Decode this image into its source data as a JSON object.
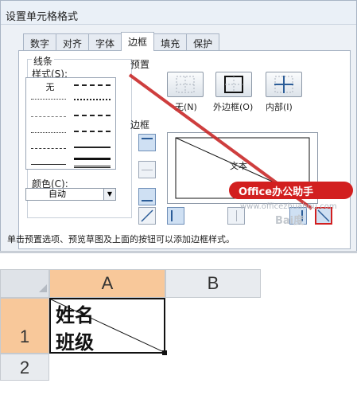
{
  "dialog": {
    "title": "设置单元格格式",
    "tabs": [
      "数字",
      "对齐",
      "字体",
      "边框",
      "填充",
      "保护"
    ],
    "active_tab": "边框",
    "line_section": "线条",
    "style_label": "样式(S):",
    "style_none": "无",
    "color_label": "颜色(C):",
    "color_value": "自动",
    "presets_label": "预置",
    "preset_none": "无(N)",
    "preset_outline": "外边框(O)",
    "preset_inside": "内部(I)",
    "border_label": "边框",
    "preview_text": "文本",
    "hint": "单击预置选项、预览草图及上面的按钮可以添加边框样式。"
  },
  "overlay": {
    "badge": "Office办公助手",
    "watermark": "www.officezhuahou.com",
    "baidu": "Bai度"
  },
  "sheet": {
    "columns": [
      "A",
      "B"
    ],
    "rows": [
      "1",
      "2"
    ],
    "cell_a1_line1": "姓名",
    "cell_a1_line2": "班级"
  },
  "colors": {
    "accent_red": "#d21f1f",
    "selected_header": "#f8c89a",
    "border_blue": "#2c5d98"
  }
}
